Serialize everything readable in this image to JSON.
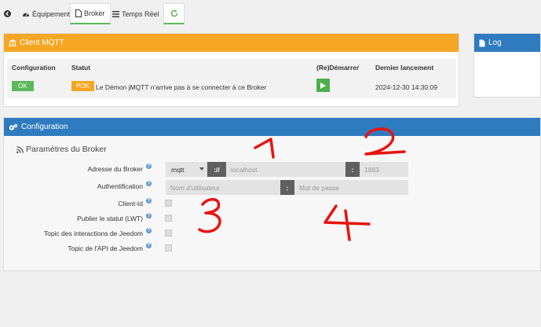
{
  "tabs": {
    "back_icon": "arrow-left-icon",
    "equipement": "Équipement",
    "broker": "Broker",
    "temps_reel": "Temps Réel",
    "refresh_icon": "refresh-icon"
  },
  "mqtt_panel": {
    "title": "Client MQTT",
    "columns": [
      "Configuration",
      "Statut",
      "(Re)Démarrer",
      "Dernier lancement"
    ],
    "config_badge": "OK",
    "status_badge": "POK",
    "status_text": "Le Démon jMQTT n'arrive pas à se connecter à ce Broker",
    "last_launch": "2024-12-30 14:30:09"
  },
  "log_panel": {
    "title": "Log"
  },
  "config_panel": {
    "title": "Configuration",
    "section_title": "Paramètres du Broker",
    "labels": {
      "address": "Adresse du Broker",
      "auth": "Authentification",
      "client_id": "Client-Id",
      "lwt": "Publier le statut (LWT)",
      "interactions": "Topic des interactions de Jeedom",
      "api": "Topic de l'API de Jeedom"
    },
    "protocol": "mqtt",
    "scheme_sep": "://",
    "host_placeholder": "localhost",
    "port_sep": ":",
    "port_placeholder": "1883",
    "user_placeholder": "Nom d'utilisateur",
    "user_sep": ":",
    "pass_placeholder": "Mot de passe"
  },
  "annotations": [
    "1",
    "2",
    "3",
    "4"
  ],
  "colors": {
    "orange": "#f5a623",
    "blue": "#2f7bbf",
    "green": "#5cb85c",
    "annotation_red": "#e8140f"
  }
}
